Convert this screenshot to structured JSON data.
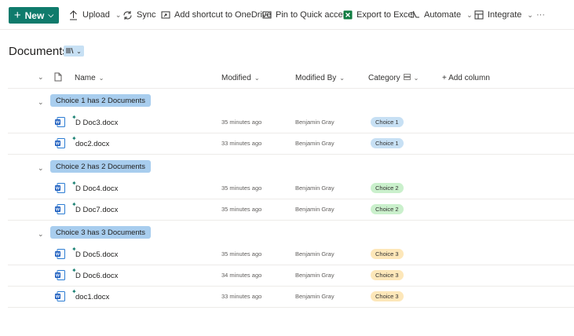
{
  "toolbar": {
    "new_label": "New",
    "upload_label": "Upload",
    "sync_label": "Sync",
    "shortcut_label": "Add shortcut to OneDrive",
    "pin_label": "Pin to Quick access",
    "export_label": "Export to Excel",
    "automate_label": "Automate",
    "integrate_label": "Integrate",
    "more_label": "···"
  },
  "page": {
    "title": "Documents"
  },
  "columns": {
    "name": "Name",
    "modified": "Modified",
    "modified_by": "Modified By",
    "category": "Category",
    "add_column": "+ Add column"
  },
  "groups": [
    {
      "label": "Choice 1 has 2 Documents",
      "color": "#c7e0f4",
      "rows": [
        {
          "name": "D Doc3.docx",
          "modified": "35 minutes ago",
          "modified_by": "Benjamin Gray",
          "category": "Choice 1"
        },
        {
          "name": "doc2.docx",
          "modified": "33 minutes ago",
          "modified_by": "Benjamin Gray",
          "category": "Choice 1"
        }
      ]
    },
    {
      "label": "Choice 2 has 2 Documents",
      "color": "#caf0cc",
      "rows": [
        {
          "name": "D Doc4.docx",
          "modified": "35 minutes ago",
          "modified_by": "Benjamin Gray",
          "category": "Choice 2"
        },
        {
          "name": "D Doc7.docx",
          "modified": "35 minutes ago",
          "modified_by": "Benjamin Gray",
          "category": "Choice 2"
        }
      ]
    },
    {
      "label": "Choice 3 has 3 Documents",
      "color": "#fde7b9",
      "rows": [
        {
          "name": "D Doc5.docx",
          "modified": "35 minutes ago",
          "modified_by": "Benjamin Gray",
          "category": "Choice 3"
        },
        {
          "name": "D Doc6.docx",
          "modified": "34 minutes ago",
          "modified_by": "Benjamin Gray",
          "category": "Choice 3"
        },
        {
          "name": "doc1.docx",
          "modified": "33 minutes ago",
          "modified_by": "Benjamin Gray",
          "category": "Choice 3"
        }
      ]
    }
  ],
  "colors": {
    "accent": "#0f7b6c",
    "group_pill": "#a8cdee",
    "word_blue": "#185abd",
    "excel_green": "#107c41"
  },
  "icons": {
    "file_type": "word-doc-icon",
    "new_badge": "new-file-sparkle-icon"
  }
}
